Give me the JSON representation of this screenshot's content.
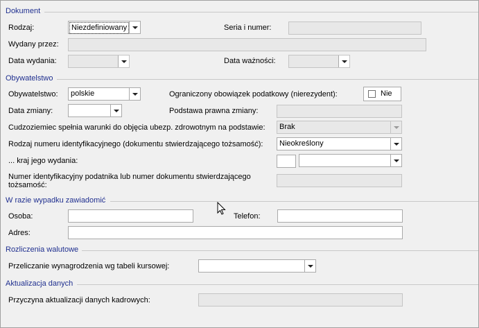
{
  "sections": {
    "dokument": "Dokument",
    "obywatelstwo": "Obywatelstwo",
    "zawiadomic": "W razie wypadku zawiadomić",
    "rozliczenia": "Rozliczenia walutowe",
    "aktualizacja": "Aktualizacja danych"
  },
  "dokument": {
    "rodzaj_label": "Rodzaj:",
    "rodzaj_value": "Niezdefiniowany",
    "seria_label": "Seria i numer:",
    "seria_value": "",
    "wydany_label": "Wydany przez:",
    "wydany_value": "",
    "data_wydania_label": "Data wydania:",
    "data_wydania_value": "",
    "data_waznosci_label": "Data ważności:",
    "data_waznosci_value": ""
  },
  "obywatelstwo": {
    "label": "Obywatelstwo:",
    "value": "polskie",
    "ograniczony_label": "Ograniczony obowiązek podatkowy (nierezydent):",
    "ograniczony_value": "Nie",
    "data_zmiany_label": "Data zmiany:",
    "data_zmiany_value": "",
    "podstawa_label": "Podstawa prawna zmiany:",
    "podstawa_value": "",
    "cudzoziemiec_label": "Cudzoziemiec spełnia warunki do objęcia ubezp. zdrowotnym na podstawie:",
    "cudzoziemiec_value": "Brak",
    "rodzaj_numeru_label": "Rodzaj numeru identyfikacyjnego (dokumentu stwierdzającego tożsamość):",
    "rodzaj_numeru_value": "Nieokreślony",
    "kraj_label": "... kraj jego wydania:",
    "kraj_code": "",
    "kraj_value": "",
    "numer_label_line1": "Numer identyfikacyjny podatnika lub numer dokumentu stwierdzającego",
    "numer_label_line2": "tożsamość:",
    "numer_value": ""
  },
  "zawiadomic": {
    "osoba_label": "Osoba:",
    "osoba_value": "",
    "telefon_label": "Telefon:",
    "telefon_value": "",
    "adres_label": "Adres:",
    "adres_value": ""
  },
  "rozliczenia": {
    "przeliczanie_label": "Przeliczanie wynagrodzenia wg tabeli kursowej:",
    "przeliczanie_value": ""
  },
  "aktualizacja": {
    "przyczyna_label": "Przyczyna aktualizacji danych kadrowych:",
    "przyczyna_value": ""
  }
}
